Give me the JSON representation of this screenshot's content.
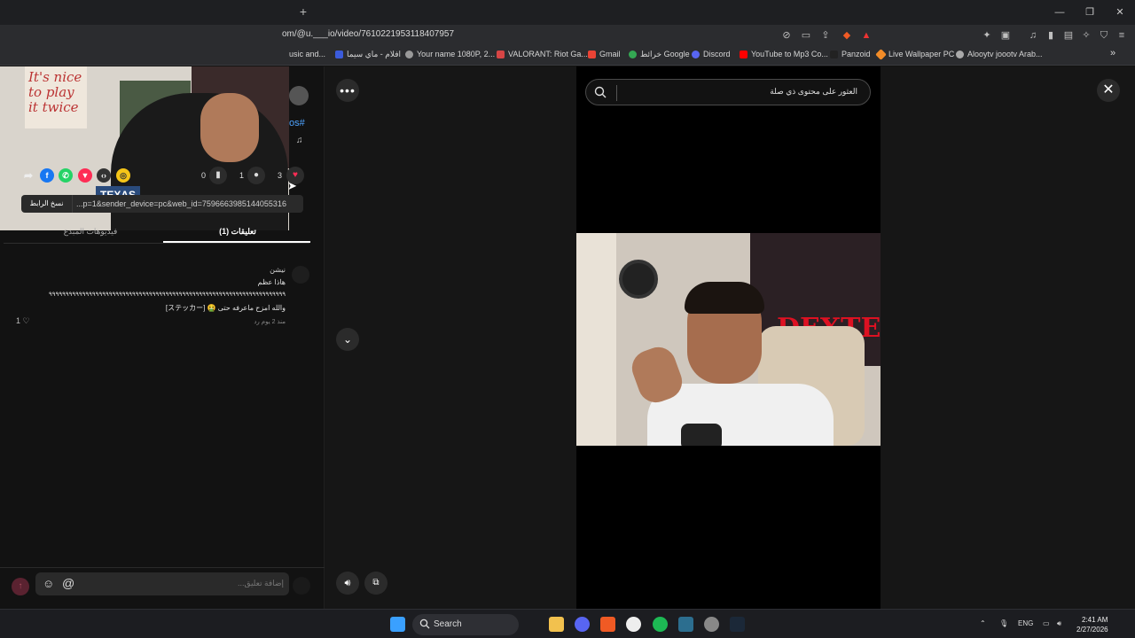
{
  "browser": {
    "url": "om/@u.___io/video/7610221953118407957",
    "bookmarks": [
      "usic and...",
      "افلام - ماي سيما",
      "Your name 1080P, 2...",
      "VALORANT: Riot Ga...",
      "Gmail",
      "خرائط Google",
      "Discord",
      "YouTube to Mp3 Co...",
      "Panzoid",
      "Live Wallpaper PC",
      "Alooytv joootv Arab..."
    ],
    "bookmark_colors": [
      "#777777",
      "#3b5bdb",
      "#999999",
      "#d64545",
      "#ea4335",
      "#34a853",
      "#5865f2",
      "#ff0000",
      "#222222",
      "#f28c28",
      "#aaaaaa"
    ]
  },
  "webcam": {
    "poster_text": "It's nice to play it twice",
    "flag_text": "TEXAS"
  },
  "side_header": {
    "hashtag": "os#",
    "music_note": "♫"
  },
  "actions": {
    "likes": "3",
    "comments": "1",
    "saves": "0"
  },
  "share": {
    "copy_link_label": "نسخ الرابط",
    "url_text": "...p=1&sender_device=pc&web_id=7596663985144055316"
  },
  "tabs": {
    "comments": "تعليقات (1)",
    "creator_videos": "فيديوهات المبدع"
  },
  "comment": {
    "author": "نيشن",
    "line1": "هاذا عظم",
    "line2": "٩٩٩٩٩٩٩٩٩٩٩٩٩٩٩٩٩٩٩٩٩٩٩٩٩٩٩٩٩٩٩٩٩٩٩٩٩٩٩٩٩٩٩٩٩٩٩٩٩٩٩٩٩٩٩٩٩٩٩٩٩٩٩٩٩٩٩٩٩٩٩",
    "line3": "والله امزح ماعرفه حتى 🤮 [ステッカー]",
    "meta": "منذ 2 يوم   رد",
    "likes": "1 ♡"
  },
  "composer": {
    "placeholder": "إضافة تعليق..."
  },
  "viewer": {
    "search_placeholder": "العثور على محتوى ذي صلة",
    "video_poster_text": "DEXTER"
  },
  "taskbar": {
    "search_label": "Search",
    "language": "ENG",
    "time": "2:41 AM",
    "date": "2/27/2026"
  }
}
